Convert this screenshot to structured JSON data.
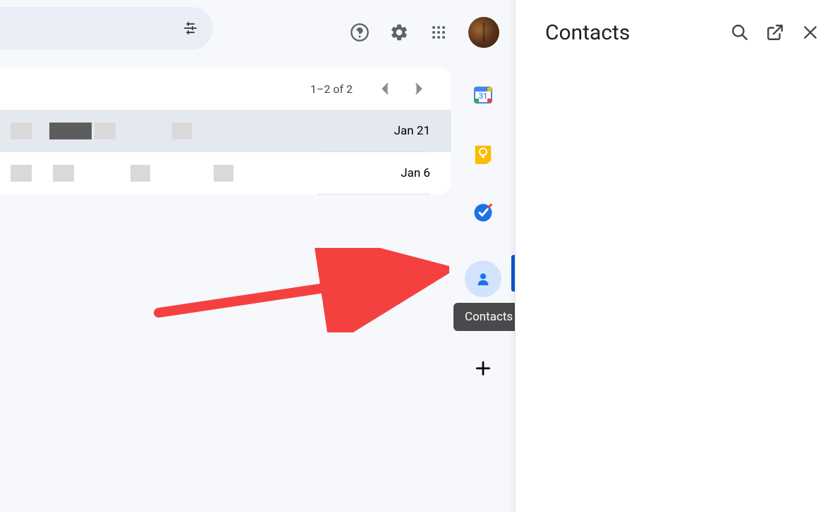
{
  "pagination": {
    "text": "1–2 of 2"
  },
  "rows": [
    {
      "date": "Jan 21"
    },
    {
      "date": "Jan 6"
    }
  ],
  "sidepanel": {
    "title": "Contacts",
    "tooltip": "Contacts"
  },
  "rail": {
    "calendar_day": "31"
  }
}
